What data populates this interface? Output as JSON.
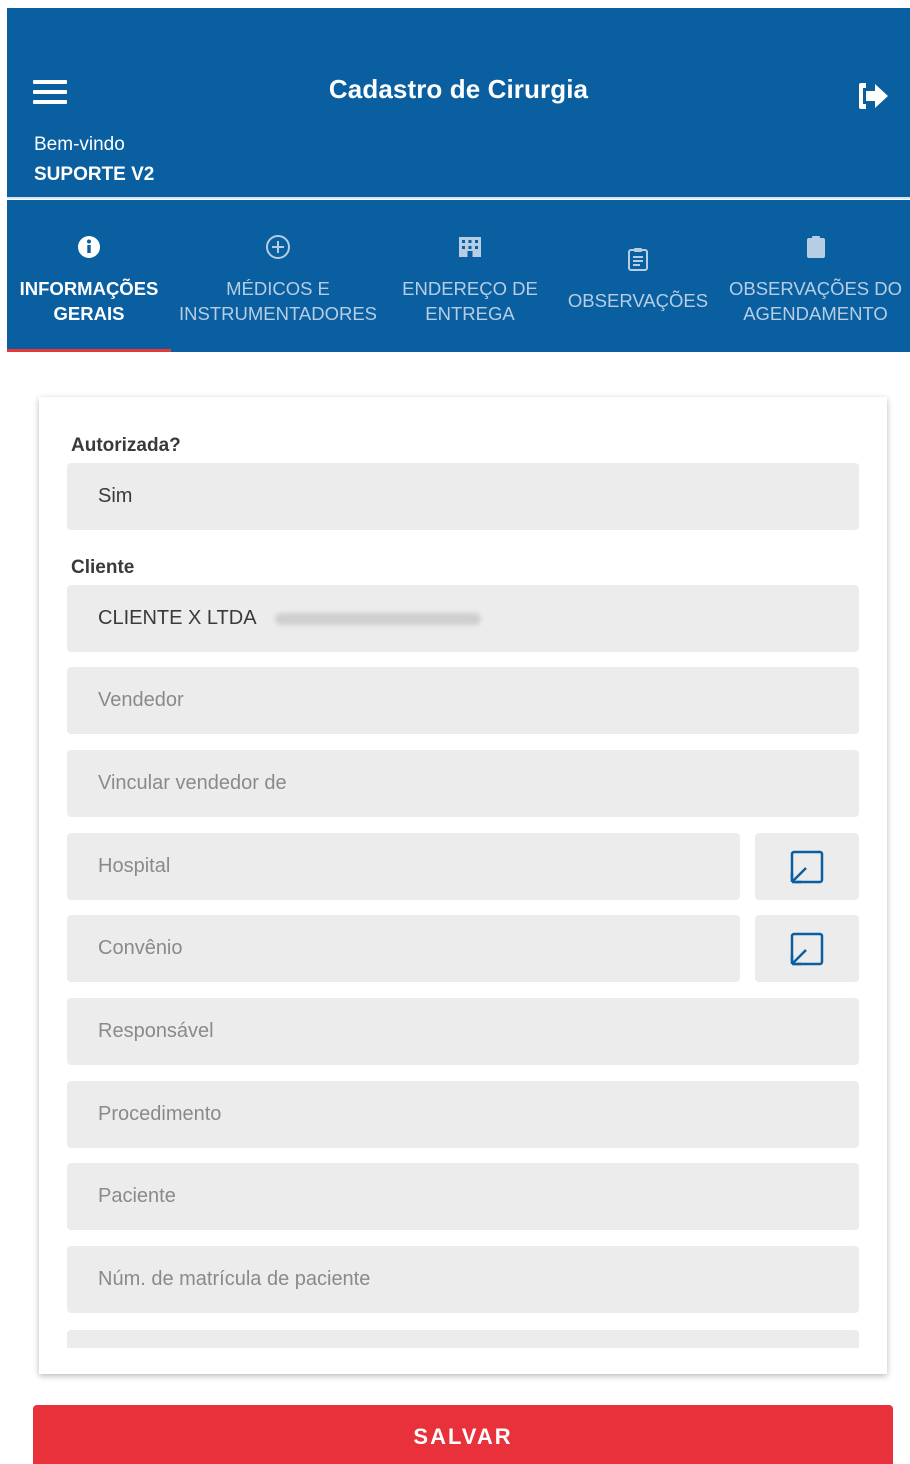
{
  "header": {
    "title": "Cadastro de Cirurgia",
    "welcome": "Bem-vindo",
    "username": "SUPORTE V2"
  },
  "tabs": [
    {
      "line1": "Informações",
      "line2": "Gerais",
      "icon": "info-icon",
      "active": true
    },
    {
      "line1": "Médicos e",
      "line2": "Instrumentadores",
      "icon": "add-circle-icon",
      "active": false
    },
    {
      "line1": "Endereço de",
      "line2": "Entrega",
      "icon": "building-icon",
      "active": false
    },
    {
      "line1": "Observações",
      "line2": "",
      "icon": "clipboard-icon",
      "active": false
    },
    {
      "line1": "Observações do",
      "line2": "Agendamento",
      "icon": "clipboard-filled-icon",
      "active": false
    }
  ],
  "form": {
    "autorizada": {
      "label": "Autorizada?",
      "value": "Sim"
    },
    "cliente": {
      "label": "Cliente",
      "value": "CLIENTE X LTDA"
    },
    "placeholders": {
      "vendedor": "Vendedor",
      "vincular": "Vincular vendedor de",
      "hospital": "Hospital",
      "convenio": "Convênio",
      "responsavel": "Responsável",
      "procedimento": "Procedimento",
      "paciente": "Paciente",
      "matricula": "Núm. de matrícula de paciente"
    }
  },
  "actions": {
    "save": "SALVAR"
  },
  "colors": {
    "primary": "#0a5fa0",
    "accent": "#e53935",
    "field_bg": "#ececec",
    "save": "#e8313b"
  }
}
